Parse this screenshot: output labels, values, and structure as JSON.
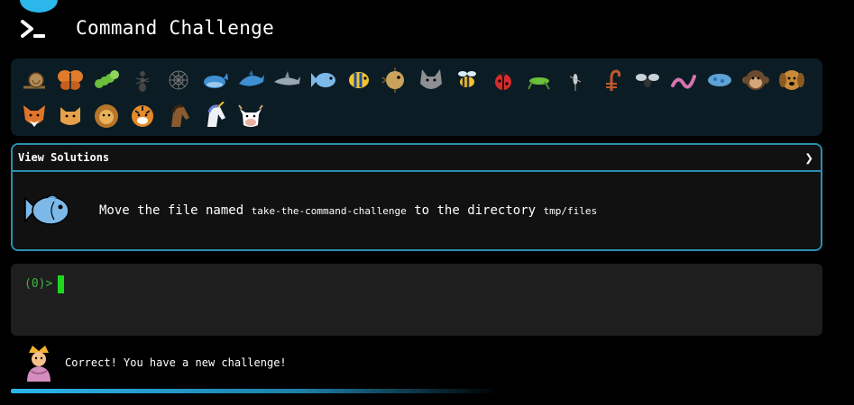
{
  "app": {
    "title": "Command Challenge",
    "logo_icon": "terminal-prompt-icon",
    "accent": "#2bb6ec"
  },
  "levels": [
    {
      "icon": "snail-icon"
    },
    {
      "icon": "butterfly-icon"
    },
    {
      "icon": "caterpillar-icon"
    },
    {
      "icon": "ant-icon"
    },
    {
      "icon": "spider-web-icon"
    },
    {
      "icon": "whale-icon"
    },
    {
      "icon": "dolphin-icon"
    },
    {
      "icon": "shark-icon"
    },
    {
      "icon": "fish-icon",
      "active": true
    },
    {
      "icon": "tropical-fish-icon"
    },
    {
      "icon": "blowfish-icon"
    },
    {
      "icon": "wolf-icon"
    },
    {
      "icon": "bee-icon"
    },
    {
      "icon": "ladybug-icon"
    },
    {
      "icon": "cricket-icon"
    },
    {
      "icon": "mosquito-icon"
    },
    {
      "icon": "scorpion-icon"
    },
    {
      "icon": "fly-icon"
    },
    {
      "icon": "worm-icon"
    },
    {
      "icon": "microbe-icon"
    },
    {
      "icon": "monkey-icon"
    },
    {
      "icon": "dog-icon"
    },
    {
      "icon": "fox-icon"
    },
    {
      "icon": "cat-icon"
    },
    {
      "icon": "lion-icon"
    },
    {
      "icon": "tiger-icon"
    },
    {
      "icon": "horse-icon"
    },
    {
      "icon": "unicorn-icon"
    },
    {
      "icon": "cow-icon"
    }
  ],
  "challenge": {
    "solutions_label": "View Solutions",
    "solutions_icon": "chevron-right-icon",
    "icon": "fish-icon",
    "text_part1": "Move the file named ",
    "file_name": "take-the-command-challenge",
    "text_part2": " to the directory ",
    "directory": "tmp/files"
  },
  "terminal": {
    "prompt": "(0)>"
  },
  "status": {
    "avatar_icon": "genie-icon",
    "message": "Correct! You have a new challenge!"
  }
}
